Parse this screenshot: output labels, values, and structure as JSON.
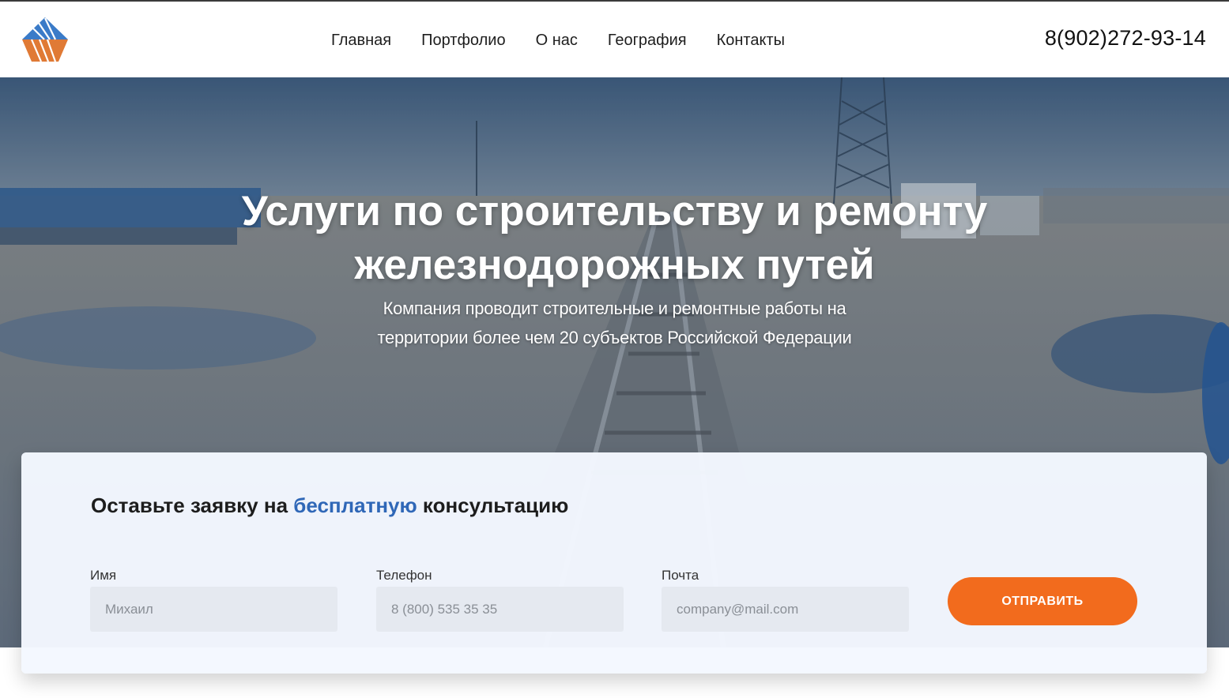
{
  "header": {
    "nav": [
      {
        "label": "Главная"
      },
      {
        "label": "Портфолио"
      },
      {
        "label": "О нас"
      },
      {
        "label": "География"
      },
      {
        "label": "Контакты"
      }
    ],
    "phone": "8(902)272-93-14"
  },
  "hero": {
    "title_line1": "Услуги по строительству и ремонту",
    "title_line2": "железнодорожных путей",
    "subtitle_line1": "Компания проводит строительные и ремонтные работы на",
    "subtitle_line2": "территории более чем 20 субъектов Российской Федерации"
  },
  "form": {
    "heading_before": "Оставьте заявку на ",
    "heading_accent": "бесплатную",
    "heading_after": " консультацию",
    "fields": [
      {
        "label": "Имя",
        "placeholder": "Михаил"
      },
      {
        "label": "Телефон",
        "placeholder": "8 (800) 535 35 35"
      },
      {
        "label": "Почта",
        "placeholder": "company@mail.com"
      }
    ],
    "submit_label": "ОТПРАВИТЬ"
  },
  "colors": {
    "accent_blue": "#2f67b7",
    "button_orange": "#f26b1d",
    "logo_blue": "#3a7bc8",
    "logo_orange": "#e07a35"
  }
}
